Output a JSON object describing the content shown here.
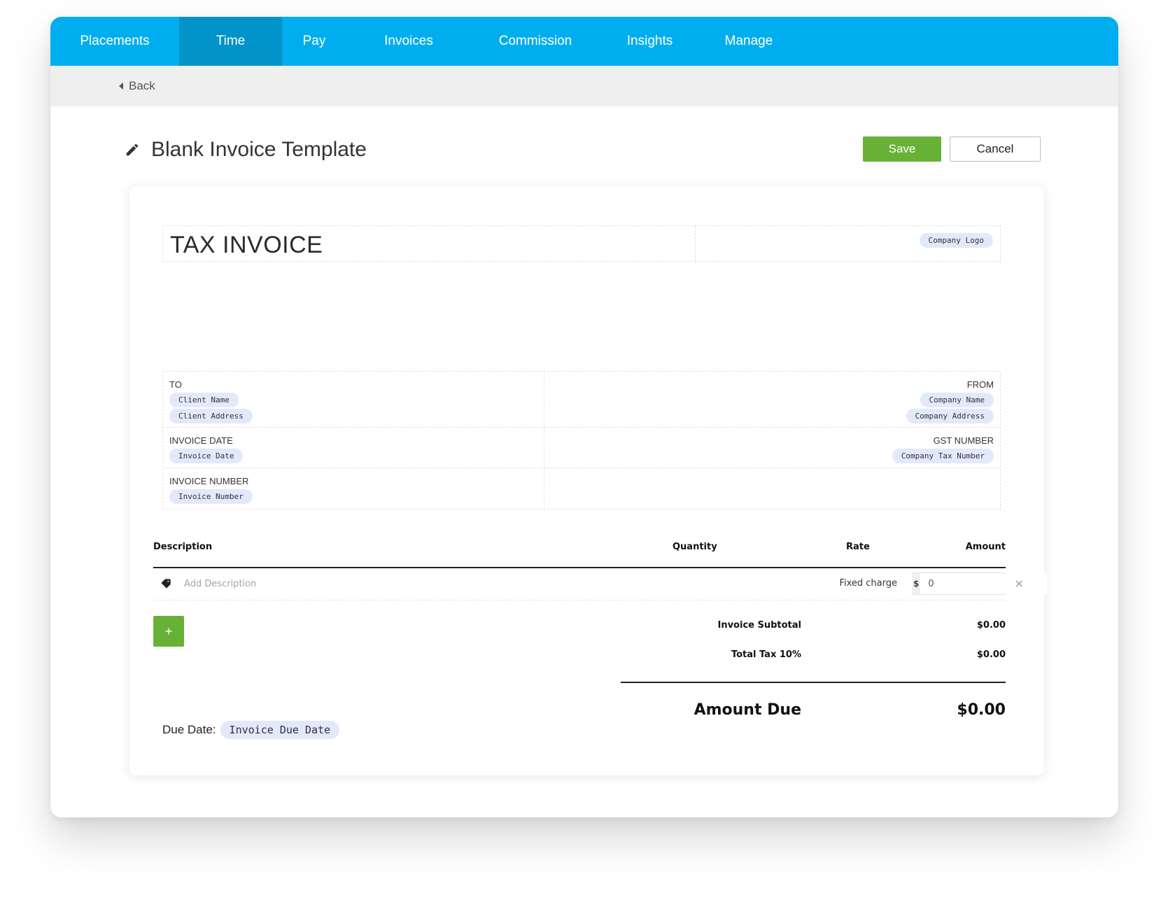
{
  "nav": {
    "tabs": [
      {
        "label": "Placements",
        "active": false
      },
      {
        "label": "Time",
        "active": true
      },
      {
        "label": "Pay",
        "active": false
      },
      {
        "label": "Invoices",
        "active": false
      },
      {
        "label": "Commission",
        "active": false
      },
      {
        "label": "Insights",
        "active": false
      },
      {
        "label": "Manage",
        "active": false
      }
    ]
  },
  "subbar": {
    "back_label": "Back"
  },
  "header": {
    "title": "Blank Invoice Template",
    "save_label": "Save",
    "cancel_label": "Cancel"
  },
  "invoice": {
    "title": "TAX INVOICE",
    "logo_chip": "Company Logo",
    "to": {
      "label": "TO",
      "chips": [
        "Client Name",
        "Client Address"
      ]
    },
    "from": {
      "label": "FROM",
      "chips": [
        "Company Name",
        "Company Address"
      ]
    },
    "invoice_date": {
      "label": "INVOICE DATE",
      "chip": "Invoice Date"
    },
    "gst_number": {
      "label": "GST NUMBER",
      "chip": "Company Tax Number"
    },
    "invoice_number": {
      "label": "INVOICE NUMBER",
      "chip": "Invoice Number"
    },
    "table": {
      "headers": {
        "description": "Description",
        "quantity": "Quantity",
        "rate": "Rate",
        "amount": "Amount"
      },
      "rows": [
        {
          "description_placeholder": "Add Description",
          "rate": "Fixed charge",
          "currency": "$",
          "amount": "0"
        }
      ],
      "add_label": "+",
      "remove_label": "×"
    },
    "summary": {
      "subtotal_label": "Invoice Subtotal",
      "subtotal_value": "$0.00",
      "tax_label": "Total Tax 10%",
      "tax_value": "$0.00",
      "amount_due_label": "Amount Due",
      "amount_due_value": "$0.00"
    },
    "due_date": {
      "label": "Due Date:",
      "chip": "Invoice Due Date"
    }
  },
  "colors": {
    "nav": "#00aeef",
    "nav_active": "#0293c8",
    "accent_green": "#67b236",
    "chip_bg": "#e1e9fb"
  }
}
